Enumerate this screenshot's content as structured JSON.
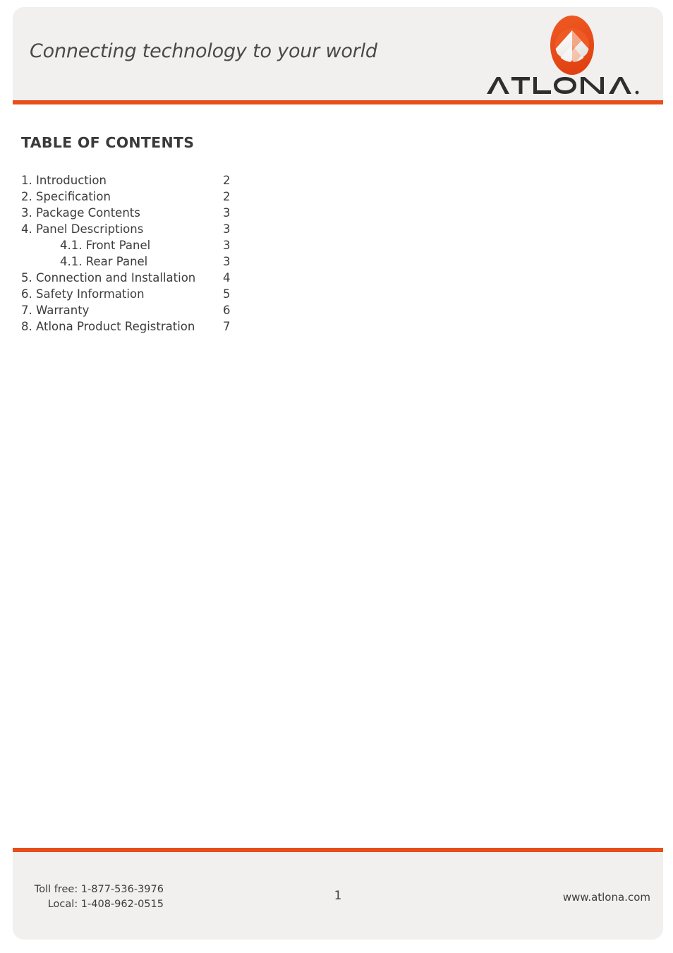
{
  "header": {
    "tagline": "Connecting technology to your world",
    "logo": {
      "mark_icon": "atlona-chevron-mark-icon",
      "wordmark": "ATLONA."
    },
    "accent_color": "#e84e1b",
    "panel_color": "#f1f0ee"
  },
  "main": {
    "toc_title": "TABLE OF CONTENTS",
    "entries": [
      {
        "label": "1. Introduction",
        "page": "2",
        "level": 1
      },
      {
        "label": "2. Specification",
        "page": "2",
        "level": 1
      },
      {
        "label": "3. Package Contents",
        "page": "3",
        "level": 1
      },
      {
        "label": "4. Panel Descriptions",
        "page": "3",
        "level": 1
      },
      {
        "label": "4.1. Front Panel",
        "page": "3",
        "level": 2
      },
      {
        "label": "4.1. Rear Panel",
        "page": "3",
        "level": 2
      },
      {
        "label": "5. Connection and Installation",
        "page": "4",
        "level": 1
      },
      {
        "label": "6. Safety Information",
        "page": "5",
        "level": 1
      },
      {
        "label": "7. Warranty",
        "page": "6",
        "level": 1
      },
      {
        "label": "8. Atlona Product Registration",
        "page": "7",
        "level": 1
      }
    ]
  },
  "footer": {
    "toll_free": "Toll free: 1-877-536-3976",
    "local": "Local: 1-408-962-0515",
    "page_number": "1",
    "website": "www.atlona.com"
  }
}
